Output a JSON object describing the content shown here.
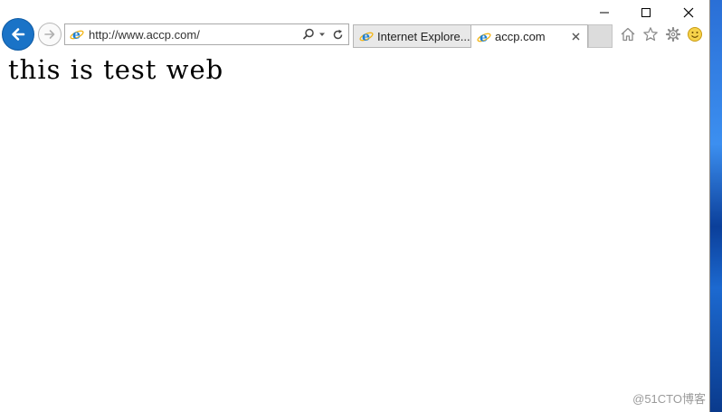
{
  "browser": {
    "address": {
      "url": "http://www.accp.com/",
      "favicon": "ie-logo-icon",
      "search_icon": "search-icon",
      "dropdown_icon": "chevron-down-icon",
      "refresh_icon": "refresh-icon"
    },
    "tabs": [
      {
        "label": "Internet Explore...",
        "favicon": "ie-logo-icon",
        "active": false
      },
      {
        "label": "accp.com",
        "favicon": "ie-logo-icon",
        "active": true,
        "close_icon": "close-icon"
      }
    ],
    "navigation": {
      "back_icon": "arrow-left-icon",
      "forward_icon": "arrow-right-icon"
    },
    "toolbar": {
      "home_icon": "home-icon",
      "favorites_icon": "star-icon",
      "tools_icon": "gear-icon",
      "feedback_icon": "smiley-icon"
    },
    "caption": {
      "minimize_icon": "minimize-icon",
      "maximize_icon": "maximize-icon",
      "close_icon": "close-icon"
    }
  },
  "page": {
    "text": "this is test web"
  },
  "watermark": "@51CTO博客",
  "colors": {
    "back_button": "#1a73c7",
    "ie_blue": "#1e7fd0",
    "ie_ring": "#f3b515"
  }
}
